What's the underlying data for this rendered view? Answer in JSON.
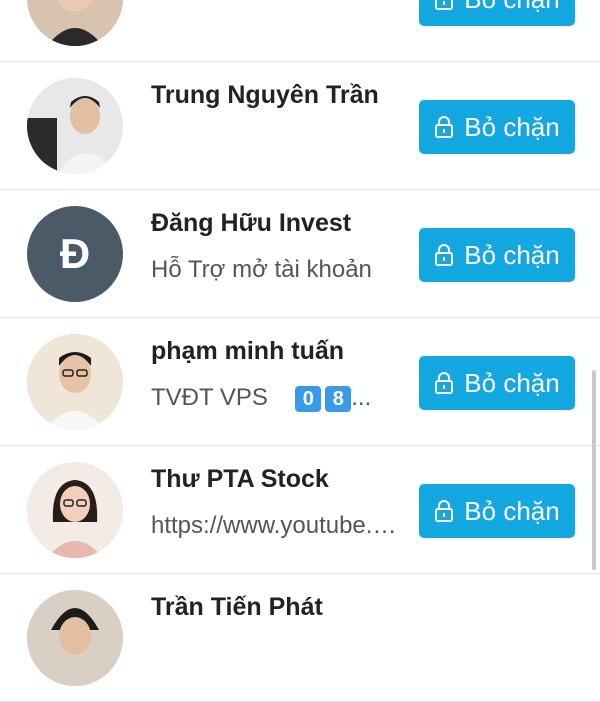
{
  "unblock_label": "Bỏ chặn",
  "users": [
    {
      "name": "",
      "subtitle": ""
    },
    {
      "name": "Trung Nguyên Trần",
      "subtitle": ""
    },
    {
      "name": "Đăng Hữu Invest",
      "subtitle": "Hỗ Trợ mở tài khoản",
      "avatar_letter": "Đ",
      "avatar_color": "#4b5a67"
    },
    {
      "name": "phạm minh tuấn",
      "subtitle": "TVĐT VPS",
      "badges": [
        "0",
        "8"
      ],
      "ellipsis": "..."
    },
    {
      "name": "Thư PTA Stock",
      "subtitle": "https://www.youtube.com"
    },
    {
      "name": "Trần Tiến Phát",
      "subtitle": ""
    }
  ],
  "colors": {
    "button": "#13a8e1",
    "badge": "#3b9ae8"
  }
}
